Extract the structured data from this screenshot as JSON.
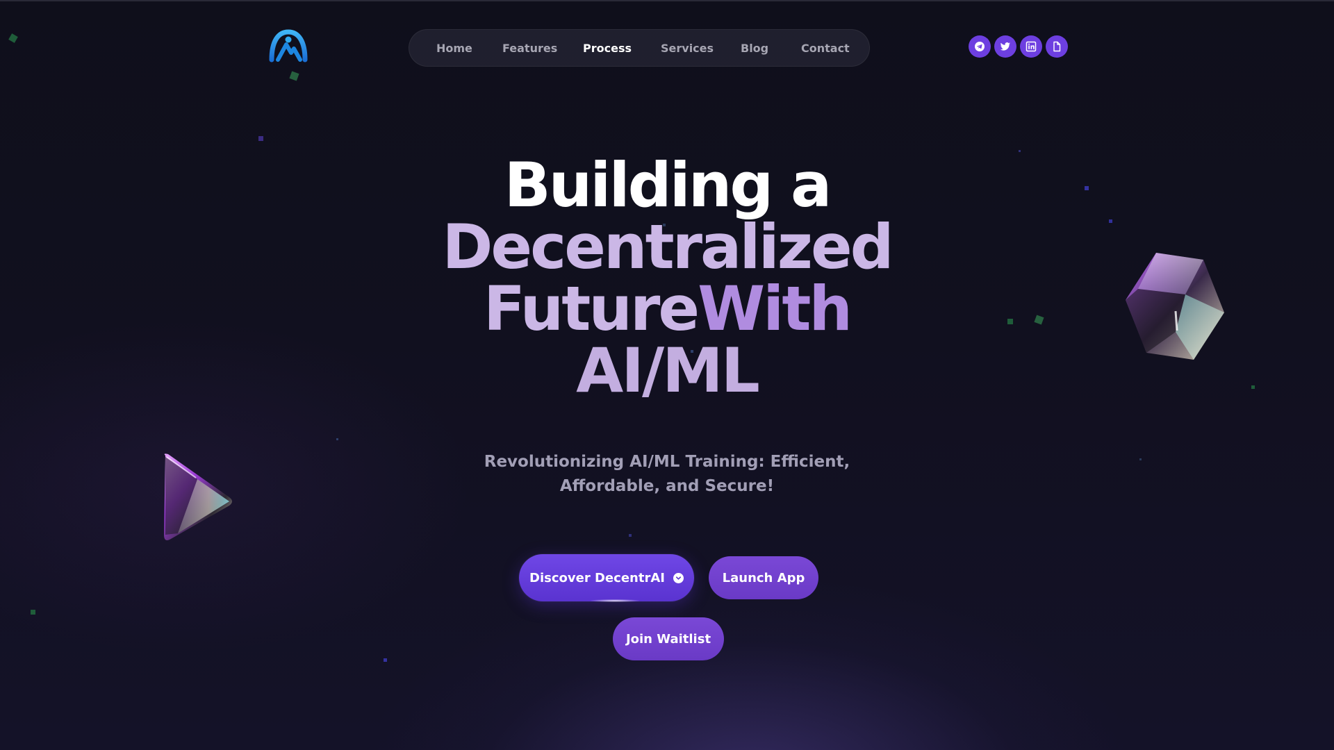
{
  "brand": {
    "logo_icon": "mountain-arc-logo-icon",
    "logo_colors": [
      "#2fa8ef",
      "#1b6fd6"
    ]
  },
  "nav": {
    "items": [
      {
        "label": "Home",
        "active": false
      },
      {
        "label": "Features",
        "active": false
      },
      {
        "label": "Process",
        "active": true
      },
      {
        "label": "Services",
        "active": false
      },
      {
        "label": "Blog",
        "active": false
      },
      {
        "label": "Contact",
        "active": false
      }
    ]
  },
  "social": {
    "items": [
      {
        "icon": "telegram-icon"
      },
      {
        "icon": "twitter-icon"
      },
      {
        "icon": "linkedin-icon"
      },
      {
        "icon": "document-icon"
      }
    ],
    "color": "#6d3fe0"
  },
  "hero": {
    "line1": "Building a",
    "line2": "Decentralized",
    "line3a": "Future",
    "line3b": "With",
    "line4": "AI/ML",
    "subtitle_line1": "Revolutionizing AI/ML Training: Efficient,",
    "subtitle_line2": "Affordable, and Secure!"
  },
  "buttons": {
    "discover_label": "Discover DecentrAI",
    "discover_icon": "chevron-down-circle-icon",
    "launch_label": "Launch App",
    "waitlist_label": "Join Waitlist"
  },
  "colors": {
    "accent": "#6f47e6",
    "heading_white": "#ffffff",
    "heading_lilac": "#cbb7e6",
    "heading_purple": "#b08ce0",
    "background": "#11101f"
  }
}
